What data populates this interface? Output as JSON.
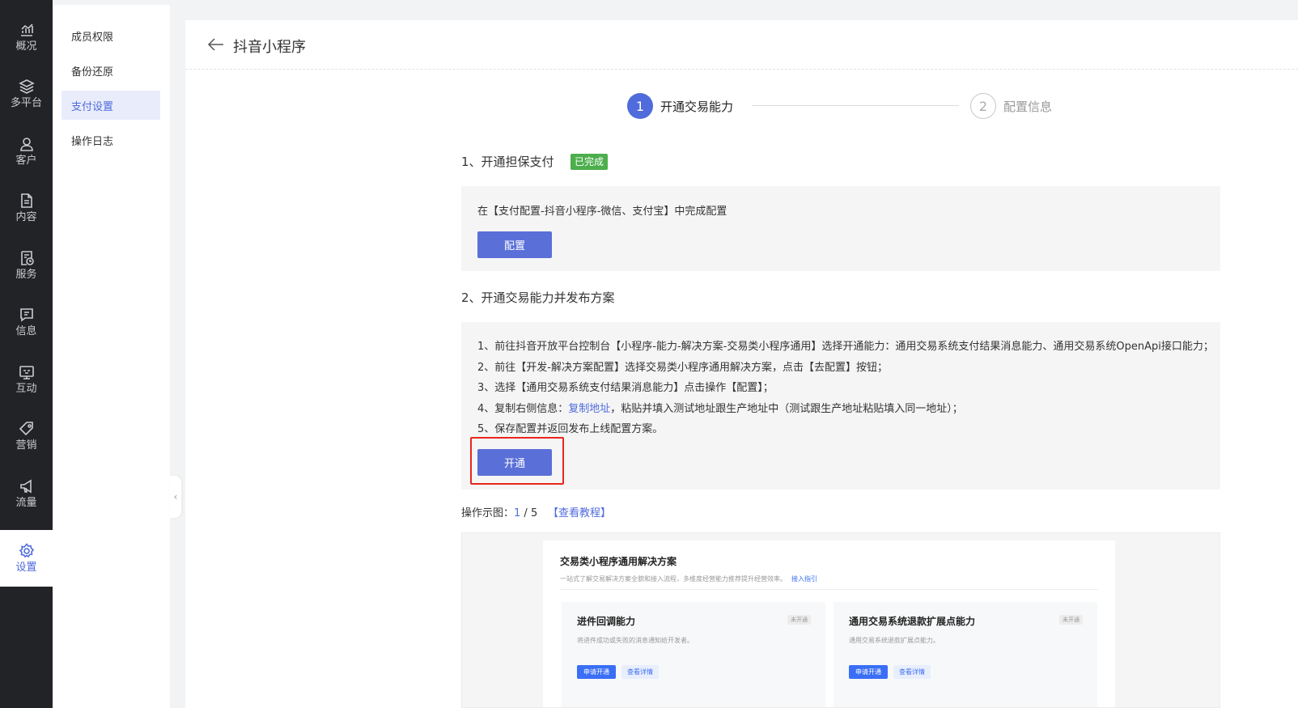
{
  "rail": {
    "items": [
      {
        "label": "概况",
        "icon": "chart-icon"
      },
      {
        "label": "多平台",
        "icon": "layers-icon"
      },
      {
        "label": "客户",
        "icon": "user-icon"
      },
      {
        "label": "内容",
        "icon": "document-icon"
      },
      {
        "label": "服务",
        "icon": "service-icon"
      },
      {
        "label": "信息",
        "icon": "message-icon"
      },
      {
        "label": "互动",
        "icon": "interact-icon"
      },
      {
        "label": "营销",
        "icon": "tag-icon"
      },
      {
        "label": "流量",
        "icon": "megaphone-icon"
      },
      {
        "label": "设置",
        "icon": "settings-icon",
        "active": true
      }
    ]
  },
  "subnav": {
    "items": [
      {
        "label": "成员权限"
      },
      {
        "label": "备份还原"
      },
      {
        "label": "支付设置",
        "active": true
      },
      {
        "label": "操作日志"
      }
    ]
  },
  "header": {
    "title": "抖音小程序"
  },
  "steps": [
    {
      "number": "1",
      "label": "开通交易能力",
      "active": true
    },
    {
      "number": "2",
      "label": "配置信息",
      "active": false
    }
  ],
  "section1": {
    "title": "1、开通担保支付",
    "badge": "已完成",
    "desc": "在【支付配置-抖音小程序-微信、支付宝】中完成配置",
    "button": "配置"
  },
  "section2": {
    "title": "2、开通交易能力并发布方案",
    "lines": [
      "1、前往抖音开放平台控制台【小程序-能力-解决方案-交易类小程序通用】选择开通能力：通用交易系统支付结果消息能力、通用交易系统OpenApi接口能力；",
      "2、前往【开发-解决方案配置】选择交易类小程序通用解决方案，点击【去配置】按钮；",
      "3、选择【通用交易系统支付结果消息能力】点击操作【配置】；"
    ],
    "line4_prefix": "4、复制右侧信息：",
    "line4_link": "复制地址",
    "line4_suffix": "，粘贴并填入测试地址跟生产地址中（测试跟生产地址粘贴填入同一地址）；",
    "line5": "5、保存配置并返回发布上线配置方案。",
    "button": "开通"
  },
  "demo": {
    "label": "操作示图：",
    "page": "1",
    "sep": " / ",
    "total": "5",
    "link": "【查看教程】"
  },
  "preview": {
    "title": "交易类小程序通用解决方案",
    "subtitle": "一站式了解交易解决方案全貌和接入流程，多维度经营能力推荐提升经营效率。",
    "subtitle_link": "接入指引",
    "cards": [
      {
        "title": "进件回调能力",
        "tag": "未开通",
        "desc": "将进件成功或失败的消息通知给开发者。",
        "btn1": "申请开通",
        "btn2": "查看详情"
      },
      {
        "title": "通用交易系统退款扩展点能力",
        "tag": "未开通",
        "desc": "通用交易系统退款扩展点能力。",
        "btn1": "申请开通",
        "btn2": "查看详情"
      }
    ]
  },
  "colors": {
    "accent": "#4f6bdc",
    "success": "#4cae4c",
    "highlight": "#e8261d",
    "rail_bg": "#222326"
  }
}
